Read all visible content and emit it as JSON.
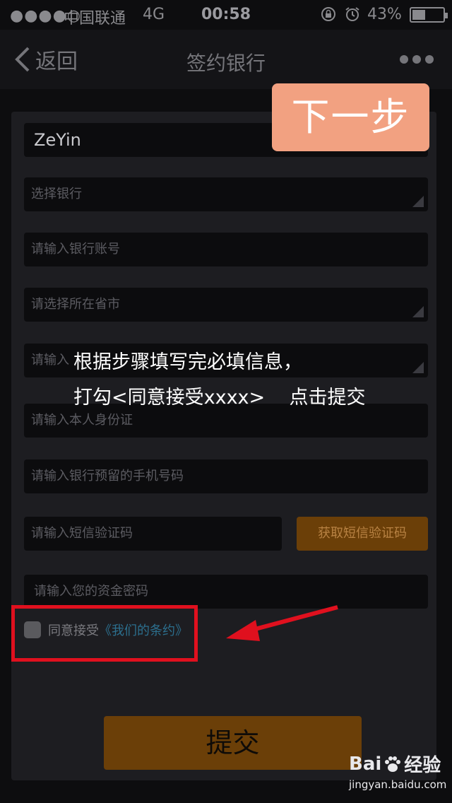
{
  "status_bar": {
    "signal": "●●●●○",
    "carrier": "中国联通",
    "network": "4G",
    "time": "00:58",
    "battery_percent": "43%",
    "battery_level": 0.43
  },
  "nav": {
    "back_label": "返回",
    "title": "签约银行"
  },
  "form": {
    "name_value": "ZeYin",
    "bank_placeholder": "选择银行",
    "account_placeholder": "请输入银行账号",
    "province_placeholder": "请选择所在省市",
    "branch_placeholder": "请输入",
    "id_placeholder": "请输入本人身份证",
    "phone_placeholder": "请输入银行预留的手机号码",
    "sms_placeholder": "请输入短信验证码",
    "sms_button": "获取短信验证码",
    "password_placeholder": "请输入您的资金密码",
    "agree_label": "同意接受",
    "terms_link": "《我们的条约》",
    "submit_label": "提交"
  },
  "overlay": {
    "next_step": "下一步",
    "instruction_line1": "根据步骤填写完必填信息，",
    "instruction_line2": "打勾<同意接受xxxx>    点击提交",
    "highlight_color": "#e0101e",
    "next_step_color": "#f2a181"
  },
  "watermark": {
    "brand_left": "Bai",
    "brand_right": "经验",
    "url": "jingyan.baidu.com"
  },
  "colors": {
    "button_brown": "#6b3f08",
    "field_bg": "#0c0c0e",
    "card_bg": "#1d1d21",
    "link": "#2c6f8e"
  }
}
